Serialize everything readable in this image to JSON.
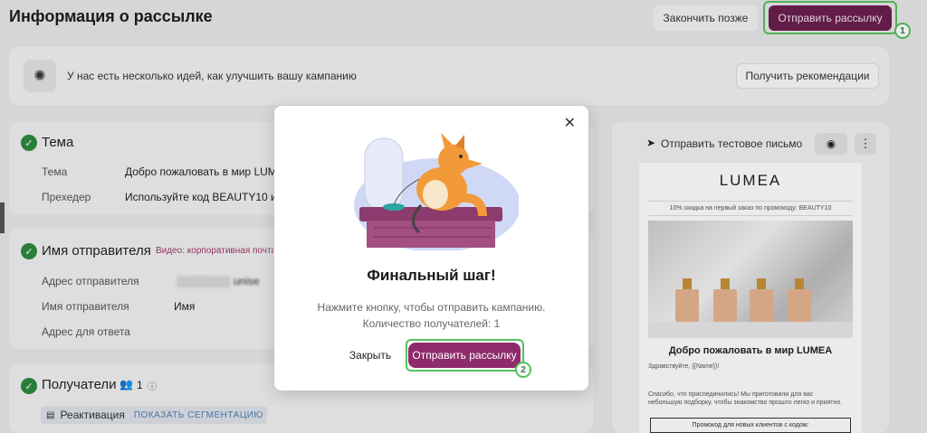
{
  "header": {
    "title": "Информация о рассылке",
    "later_label": "Закончить позже",
    "send_label": "Отправить рассылку",
    "badge_top": "1"
  },
  "tips": {
    "text": "У нас есть несколько идей, как улучшить вашу кампанию",
    "button_label": "Получить рекомендации"
  },
  "theme_section": {
    "title": "Тема",
    "rows": [
      {
        "label": "Тема",
        "value": "Добро пожаловать в мир LUMEA"
      },
      {
        "label": "Прехедер",
        "value": "Используйте код BEAUTY10 и"
      }
    ]
  },
  "sender_section": {
    "title": "Имя отправителя",
    "video_link": "Видео: корпоративная почта",
    "rows": [
      {
        "label": "Адрес отправителя",
        "value": "unise"
      },
      {
        "label": "Имя отправителя",
        "value": "Имя"
      },
      {
        "label": "Адрес для ответа",
        "value": ""
      }
    ]
  },
  "recipients_section": {
    "title": "Получатели",
    "count": "1",
    "segment": "Реактивация",
    "segment_link": "ПОКАЗАТЬ СЕГМЕНТАЦИЮ"
  },
  "preview": {
    "test_send_label": "Отправить тестовое письмо",
    "mail_logo": "LUMEA",
    "mail_promo": "10% скидка на первый заказ по промокоду: BEAUTY10",
    "mail_title": "Добро пожаловать в мир LUMEA",
    "mail_greeting": "Здравствуйте, {{Name}}!",
    "mail_body": "Спасибо, что присоединились! Мы приготовили для вас небольшую подборку, чтобы знакомство прошло легко и приятно.",
    "mail_box": "Промокод для новых клиентов с кодом:"
  },
  "modal": {
    "title": "Финальный шаг!",
    "desc_line1": "Нажмите кнопку, чтобы отправить кампанию.",
    "desc_line2": "Количество получателей: 1",
    "close_label": "Закрыть",
    "send_label": "Отправить рассылку",
    "badge": "2"
  },
  "colors": {
    "brand": "#6a1f4f",
    "brand_button": "#8d2b6b",
    "highlight": "#57c05e",
    "check": "#2d8a3e"
  }
}
